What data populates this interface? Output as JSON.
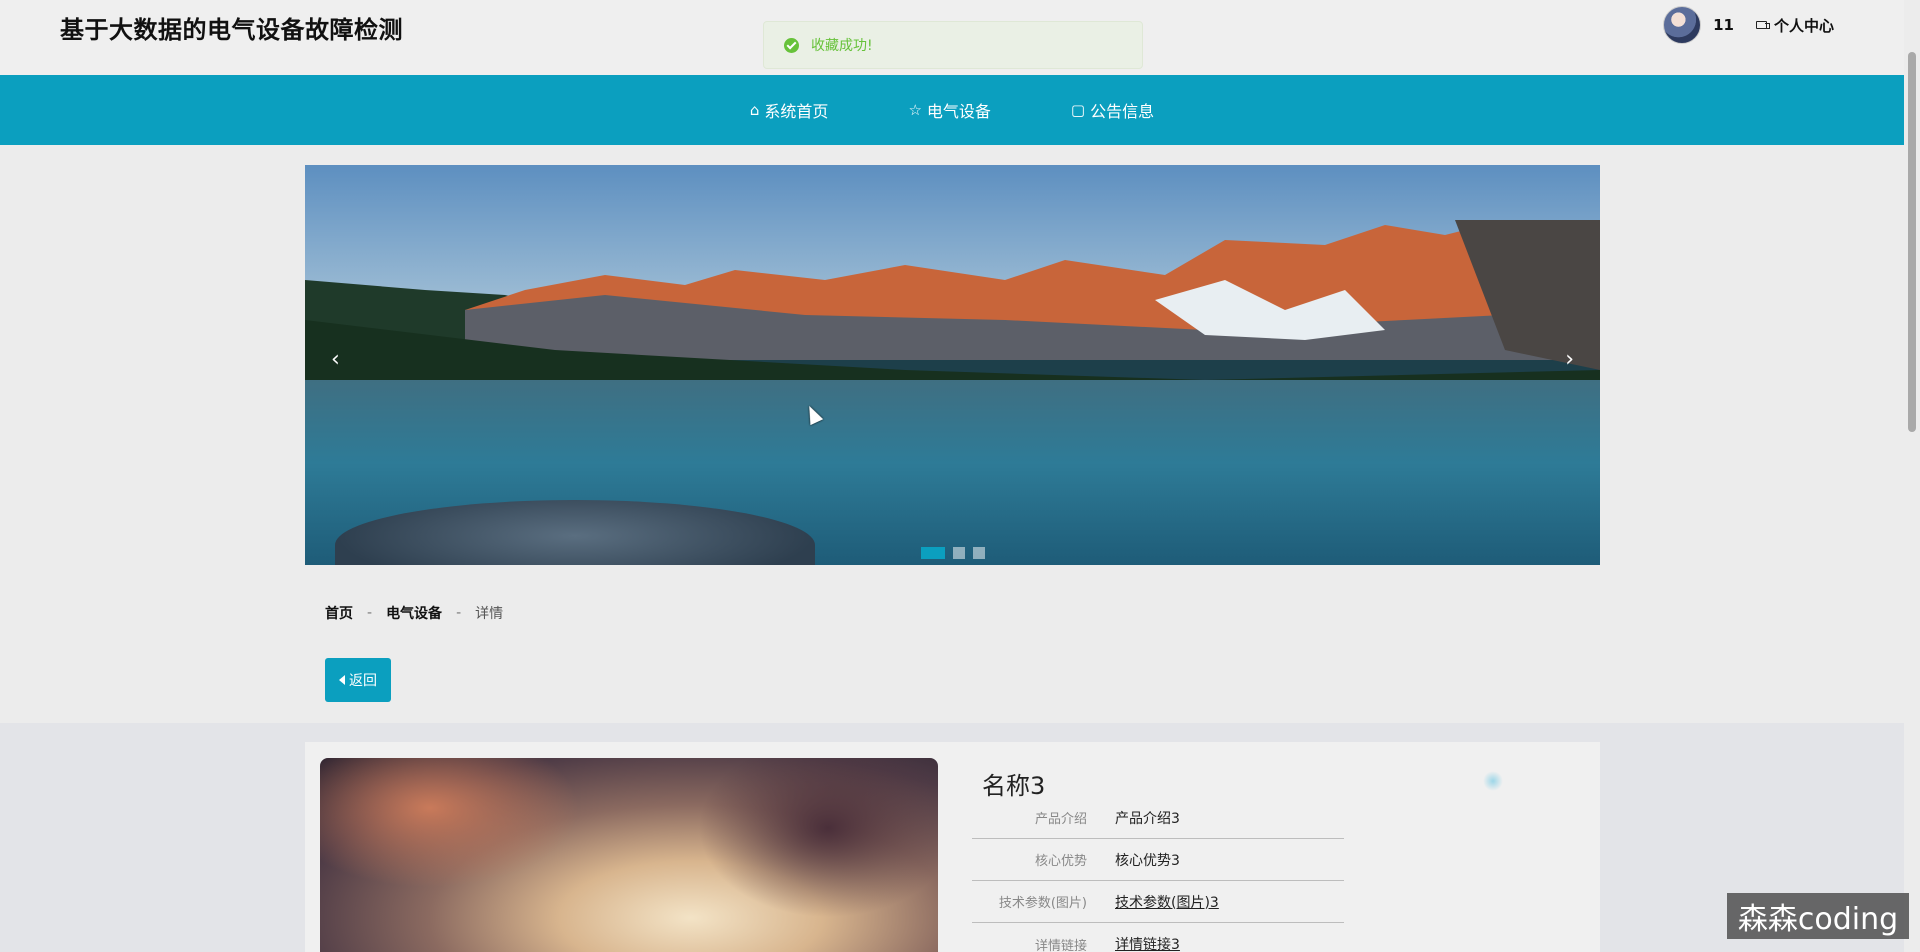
{
  "header": {
    "site_title": "基于大数据的电气设备故障检测",
    "username": "11",
    "personal_center": "个人中心"
  },
  "toast": {
    "message": "收藏成功!"
  },
  "nav": {
    "items": [
      {
        "label": "系统首页",
        "icon": "home-icon"
      },
      {
        "label": "电气设备",
        "icon": "star-icon"
      },
      {
        "label": "公告信息",
        "icon": "bag-icon"
      }
    ]
  },
  "carousel": {
    "prev": "‹",
    "next": "›",
    "slide_count": 3,
    "active_index": 0
  },
  "breadcrumb": {
    "home": "首页",
    "sep": "-",
    "category": "电气设备",
    "current": "详情"
  },
  "back_button": {
    "label": "返回"
  },
  "detail": {
    "title": "名称3",
    "attributes": [
      {
        "label": "产品介绍",
        "value": "产品介绍3",
        "link": false
      },
      {
        "label": "核心优势",
        "value": "核心优势3",
        "link": false
      },
      {
        "label": "技术参数(图片)",
        "value": "技术参数(图片)3",
        "link": true
      },
      {
        "label": "详情链接",
        "value": "详情链接3",
        "link": true
      }
    ]
  },
  "watermark": "森森coding",
  "colors": {
    "accent": "#0b9fbf",
    "success": "#67c23a"
  }
}
